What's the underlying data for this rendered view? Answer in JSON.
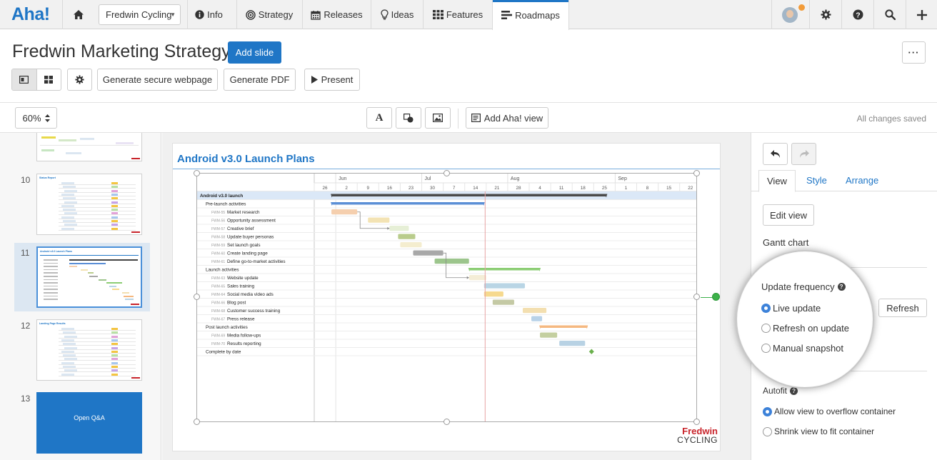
{
  "nav": {
    "logo": "Aha!",
    "workspace": "Fredwin Cycling",
    "items": [
      {
        "label": "Info",
        "icon": "info-icon"
      },
      {
        "label": "Strategy",
        "icon": "strategy-icon"
      },
      {
        "label": "Releases",
        "icon": "calendar-icon"
      },
      {
        "label": "Ideas",
        "icon": "lightbulb-icon"
      },
      {
        "label": "Features",
        "icon": "grid-icon"
      },
      {
        "label": "Roadmaps",
        "icon": "roadmap-icon",
        "active": true
      }
    ],
    "right_icons": [
      "avatar",
      "gear-icon",
      "help-icon",
      "search-icon",
      "plus-icon"
    ]
  },
  "header": {
    "title": "Fredwin Marketing Strategy",
    "add_slide": "Add slide",
    "more": "···",
    "generate_webpage": "Generate secure webpage",
    "generate_pdf": "Generate PDF",
    "present": "Present"
  },
  "toolbar": {
    "zoom": "60%",
    "text_tool": "A",
    "add_view": "Add Aha! view",
    "save_status": "All changes saved"
  },
  "slides": [
    {
      "number": "10",
      "title": "Status Report"
    },
    {
      "number": "11",
      "title": "Android v3.0 Launch Plans",
      "selected": true
    },
    {
      "number": "12",
      "title": "Landing Page Results"
    },
    {
      "number": "13",
      "title": "Open Q&A"
    }
  ],
  "slide": {
    "title": "Android v3.0 Launch Plans",
    "brand_line1": "Fredwin",
    "brand_line2": "CYCLING"
  },
  "gantt": {
    "months": [
      {
        "label": "Jun",
        "col": 1
      },
      {
        "label": "Jul",
        "col": 5
      },
      {
        "label": "Aug",
        "col": 9
      },
      {
        "label": "Sep",
        "col": 14
      }
    ],
    "weeks": [
      "26",
      "2",
      "9",
      "16",
      "23",
      "30",
      "7",
      "14",
      "21",
      "28",
      "4",
      "11",
      "18",
      "25",
      "1",
      "8",
      "15",
      "22"
    ],
    "today_week": 7.95,
    "rows": [
      {
        "id": "",
        "name": "Android v3.0 launch",
        "level": 0,
        "bold": true,
        "highlight": true,
        "bar": {
          "start": 0.8,
          "end": 13.6,
          "color": "#4a4a4a",
          "kind": "summary"
        }
      },
      {
        "id": "",
        "name": "Pre-launch activities",
        "level": 1,
        "bar": {
          "start": 0.8,
          "end": 7.9,
          "color": "#5b8fd6",
          "kind": "summary"
        }
      },
      {
        "id": "FWM-55",
        "name": "Market research",
        "level": 2,
        "bar": {
          "start": 0.8,
          "end": 2.0,
          "color": "#f5cfae"
        }
      },
      {
        "id": "FWM-56",
        "name": "Opportunity assessment",
        "level": 2,
        "bar": {
          "start": 2.5,
          "end": 3.5,
          "color": "#f3e3b4"
        }
      },
      {
        "id": "FWM-57",
        "name": "Creative brief",
        "level": 2,
        "bar": {
          "start": 3.5,
          "end": 4.4,
          "color": "#e6efd6"
        }
      },
      {
        "id": "FWM-58",
        "name": "Update buyer personas",
        "level": 2,
        "bar": {
          "start": 3.9,
          "end": 4.7,
          "color": "#b9cc8c"
        }
      },
      {
        "id": "FWM-59",
        "name": "Set launch goals",
        "level": 2,
        "bar": {
          "start": 4.0,
          "end": 5.0,
          "color": "#f4edcf"
        }
      },
      {
        "id": "FWM-60",
        "name": "Create landing page",
        "level": 2,
        "bar": {
          "start": 4.6,
          "end": 6.0,
          "color": "#a8a8a8"
        }
      },
      {
        "id": "FWM-61",
        "name": "Define go-to-market activities",
        "level": 2,
        "bar": {
          "start": 5.6,
          "end": 7.2,
          "color": "#9cc58c"
        }
      },
      {
        "id": "",
        "name": "Launch activities",
        "level": 1,
        "bar": {
          "start": 7.2,
          "end": 10.5,
          "color": "#8ccd74",
          "kind": "summary"
        }
      },
      {
        "id": "FWM-63",
        "name": "Website update",
        "level": 2,
        "bar": {
          "start": 7.2,
          "end": 8.0,
          "color": "#f4edd6"
        }
      },
      {
        "id": "FWM-65",
        "name": "Sales training",
        "level": 2,
        "bar": {
          "start": 7.9,
          "end": 9.8,
          "color": "#b9d5e5"
        }
      },
      {
        "id": "FWM-64",
        "name": "Social media video ads",
        "level": 2,
        "bar": {
          "start": 7.9,
          "end": 8.8,
          "color": "#f6d98e"
        }
      },
      {
        "id": "FWM-66",
        "name": "Blog post",
        "level": 2,
        "bar": {
          "start": 8.3,
          "end": 9.3,
          "color": "#c4c9a4"
        }
      },
      {
        "id": "FWM-68",
        "name": "Customer success training",
        "level": 2,
        "bar": {
          "start": 9.7,
          "end": 10.8,
          "color": "#f3dfb0"
        }
      },
      {
        "id": "FWM-67",
        "name": "Press release",
        "level": 2,
        "bar": {
          "start": 10.1,
          "end": 10.6,
          "color": "#b8d2e8"
        }
      },
      {
        "id": "",
        "name": "Post launch activities",
        "level": 1,
        "bar": {
          "start": 10.5,
          "end": 12.7,
          "color": "#f5b880",
          "kind": "summary"
        }
      },
      {
        "id": "FWM-69",
        "name": "Media follow-ups",
        "level": 2,
        "bar": {
          "start": 10.5,
          "end": 11.3,
          "color": "#c4cfa0"
        }
      },
      {
        "id": "FWM-70",
        "name": "Results reporting",
        "level": 2,
        "bar": {
          "start": 11.4,
          "end": 12.6,
          "color": "#b8d2e4"
        }
      },
      {
        "id": "",
        "name": "Complete by date",
        "level": 1,
        "milestone": 12.9
      }
    ]
  },
  "panel": {
    "tabs": [
      "View",
      "Style",
      "Arrange"
    ],
    "edit_view": "Edit view",
    "view_type": "Gantt chart",
    "update_frequency_label": "Update frequency",
    "update_options": [
      "Live update",
      "Refresh on update",
      "Manual snapshot"
    ],
    "update_selected": 0,
    "refresh": "Refresh",
    "autofit_label": "Autofit",
    "autofit_options": [
      "Allow view to overflow container",
      "Shrink view to fit container"
    ],
    "autofit_selected": 0,
    "colors": {
      "accent": "#1f76c6",
      "radio": "#3d82d9",
      "handle": "#3cb14a"
    }
  }
}
